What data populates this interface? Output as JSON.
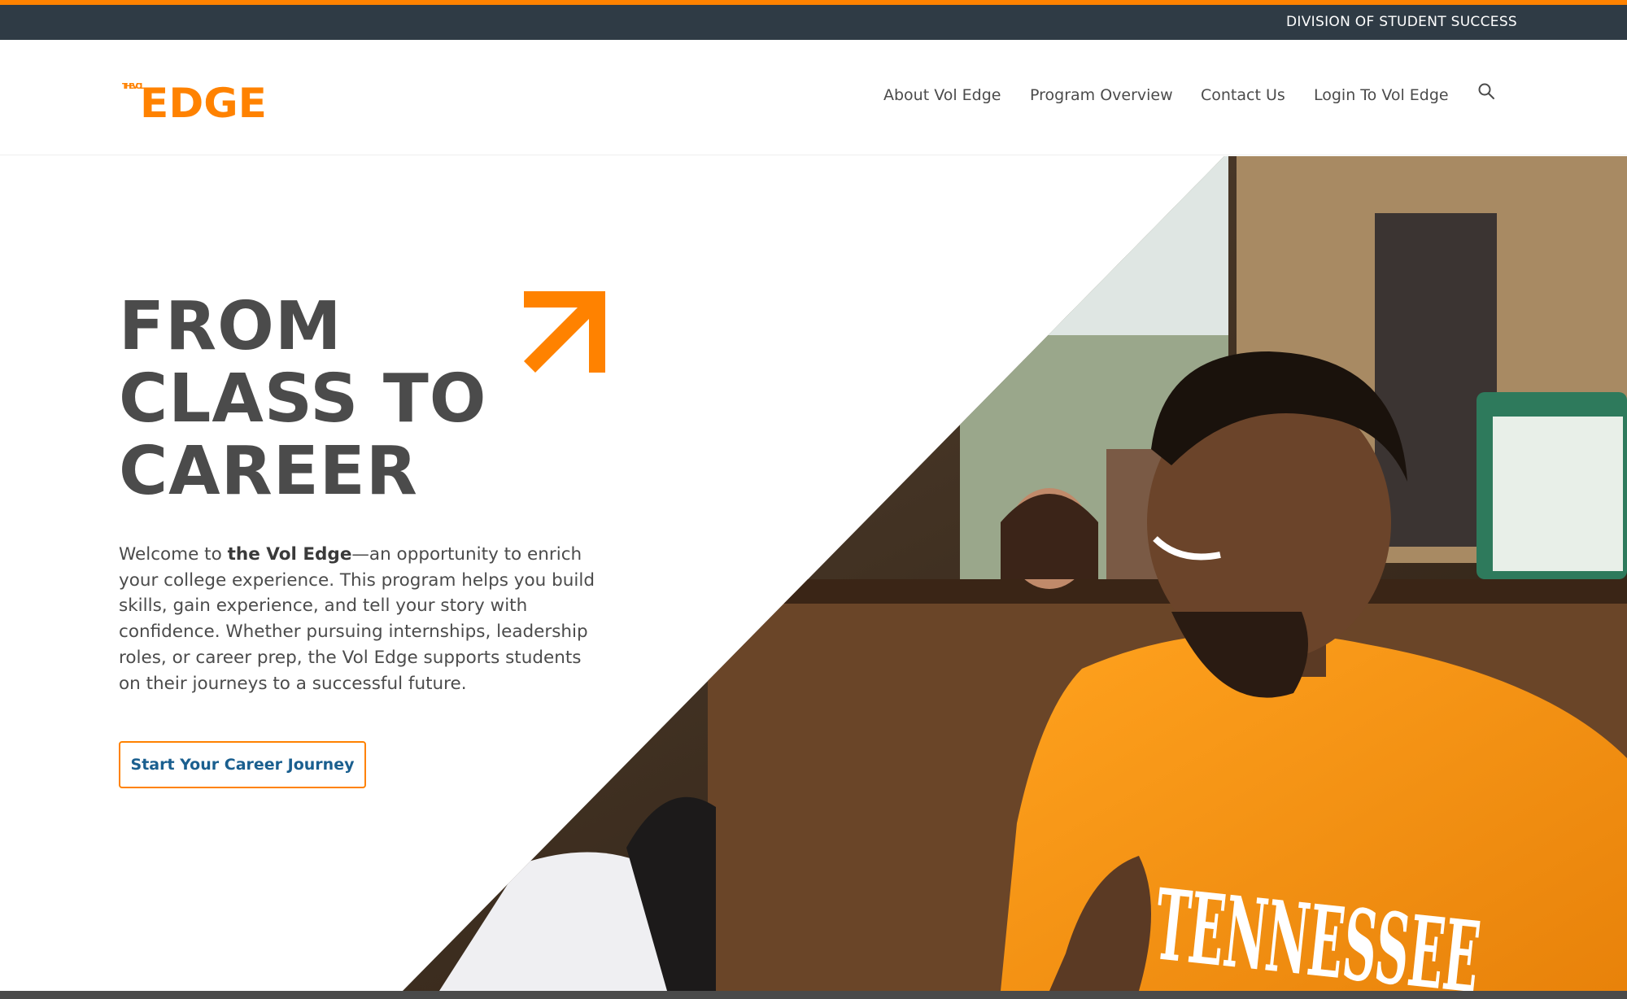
{
  "utility": {
    "link": "DIVISION OF STUDENT SUCCESS"
  },
  "brand": {
    "logo_small": "THE VOL",
    "logo_big": "EDGE",
    "accent_color": "#ff8200",
    "dark_color": "#2f3b45",
    "text_color": "#4b4b4b",
    "link_color": "#1a5f8f"
  },
  "nav": {
    "items": [
      {
        "label": "About Vol Edge"
      },
      {
        "label": "Program Overview"
      },
      {
        "label": "Contact Us"
      },
      {
        "label": "Login To Vol Edge"
      }
    ],
    "search_icon": "search-icon"
  },
  "hero": {
    "heading": [
      "FROM",
      "CLASS TO",
      "CAREER"
    ],
    "arrow_icon": "arrow-up-right-icon",
    "body_pre": "Welcome to ",
    "body_bold": "the Vol Edge",
    "body_post": "—an opportunity to enrich your college experience. This program helps you build skills, gain experience, and tell your story with confidence. Whether pursuing internships, leadership roles, or career prep, the Vol Edge supports students on their journeys to a successful future.",
    "cta_label": "Start Your Career Journey",
    "photo_shirt_text": "TENNESSEE"
  }
}
